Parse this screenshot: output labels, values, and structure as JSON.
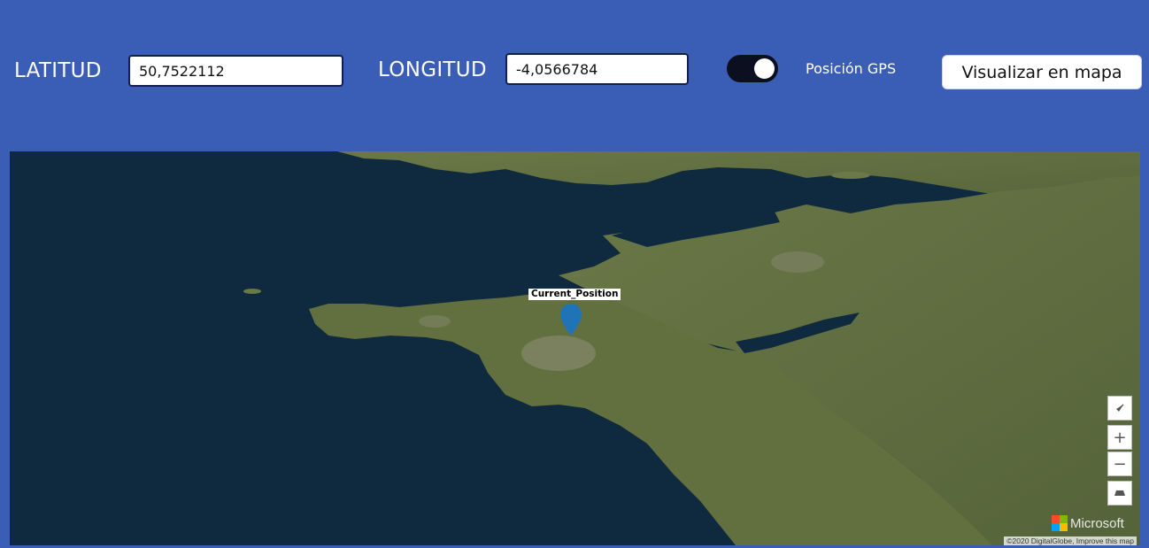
{
  "form": {
    "lat_label": "LATITUD",
    "lat_value": "50,7522112",
    "lon_label": "LONGITUD",
    "lon_value": "-4,0566784",
    "gps_toggle_on": true,
    "gps_label": "Posición GPS",
    "visualize_button": "Visualizar en mapa"
  },
  "map": {
    "pin_label": "Current_Position",
    "pin_color": "#1f73b7",
    "controls": {
      "compass_icon": "compass-icon",
      "zoom_in": "+",
      "zoom_out": "−",
      "pitch_icon": "pitch-icon"
    },
    "logo_text": "Microsoft",
    "attribution": "©2020 DigitalGlobe, Improve this map"
  },
  "colors": {
    "background": "#3a5db5",
    "ocean": "#0f2a3f",
    "land": "#5e6b3c"
  }
}
